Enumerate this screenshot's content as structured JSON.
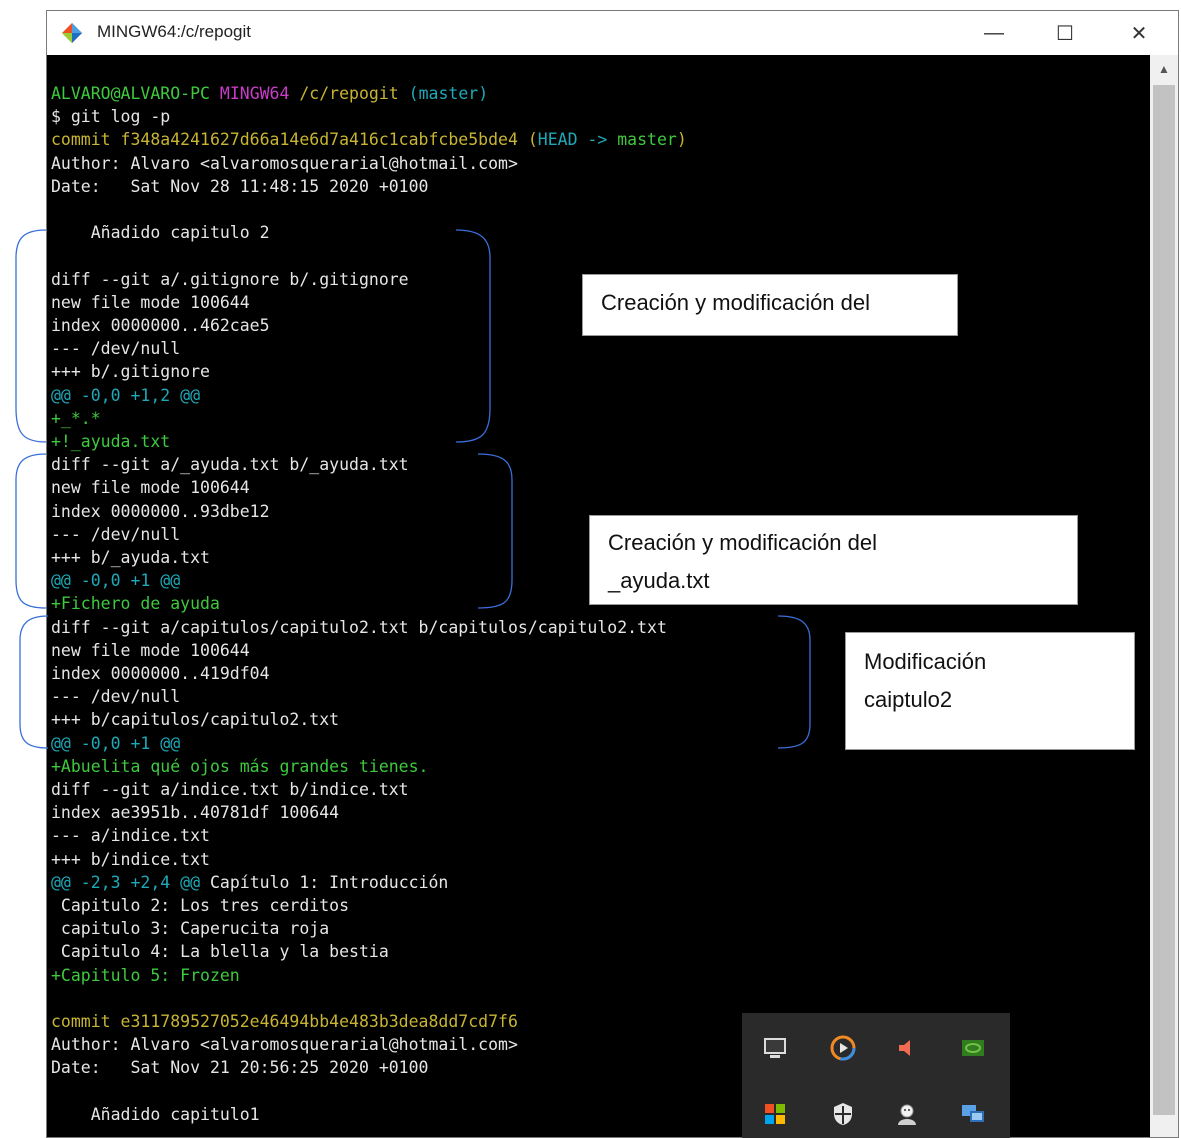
{
  "window": {
    "title": "MINGW64:/c/repogit",
    "controls": {
      "minimize": "—",
      "maximize": "☐",
      "close": "✕"
    }
  },
  "terminal": {
    "lines": [
      {
        "segments": [
          {
            "text": "ALVARO@ALVARO-PC ",
            "color": "green"
          },
          {
            "text": "MINGW64 ",
            "color": "magenta"
          },
          {
            "text": "/c/repogit ",
            "color": "yellow"
          },
          {
            "text": "(master)",
            "color": "cyan"
          }
        ]
      },
      {
        "segments": [
          {
            "text": "$ git log -p",
            "color": "white"
          }
        ]
      },
      {
        "segments": [
          {
            "text": "commit f348a4241627d66a14e6d7a416c1cabfcbe5bde4 ",
            "color": "yellow"
          },
          {
            "text": "(",
            "color": "yellow"
          },
          {
            "text": "HEAD -> ",
            "color": "cyan"
          },
          {
            "text": "master",
            "color": "green"
          },
          {
            "text": ")",
            "color": "yellow"
          }
        ]
      },
      {
        "segments": [
          {
            "text": "Author: Alvaro <alvaromosquerarial@hotmail.com>",
            "color": "white"
          }
        ]
      },
      {
        "segments": [
          {
            "text": "Date:   Sat Nov 28 11:48:15 2020 +0100",
            "color": "white"
          }
        ]
      },
      {
        "segments": [
          {
            "text": "",
            "color": "white"
          }
        ]
      },
      {
        "segments": [
          {
            "text": "    Añadido capitulo 2",
            "color": "white"
          }
        ]
      },
      {
        "segments": [
          {
            "text": "",
            "color": "white"
          }
        ]
      },
      {
        "segments": [
          {
            "text": "diff --git a/.gitignore b/.gitignore",
            "color": "white"
          }
        ]
      },
      {
        "segments": [
          {
            "text": "new file mode 100644",
            "color": "white"
          }
        ]
      },
      {
        "segments": [
          {
            "text": "index 0000000..462cae5",
            "color": "white"
          }
        ]
      },
      {
        "segments": [
          {
            "text": "--- /dev/null",
            "color": "white"
          }
        ]
      },
      {
        "segments": [
          {
            "text": "+++ b/.gitignore",
            "color": "white"
          }
        ]
      },
      {
        "segments": [
          {
            "text": "@@ -0,0 +1,2 @@",
            "color": "cyan"
          }
        ]
      },
      {
        "segments": [
          {
            "text": "+_*.*",
            "color": "green"
          }
        ]
      },
      {
        "segments": [
          {
            "text": "+!_ayuda.txt",
            "color": "green"
          }
        ]
      },
      {
        "segments": [
          {
            "text": "diff --git a/_ayuda.txt b/_ayuda.txt",
            "color": "white"
          }
        ]
      },
      {
        "segments": [
          {
            "text": "new file mode 100644",
            "color": "white"
          }
        ]
      },
      {
        "segments": [
          {
            "text": "index 0000000..93dbe12",
            "color": "white"
          }
        ]
      },
      {
        "segments": [
          {
            "text": "--- /dev/null",
            "color": "white"
          }
        ]
      },
      {
        "segments": [
          {
            "text": "+++ b/_ayuda.txt",
            "color": "white"
          }
        ]
      },
      {
        "segments": [
          {
            "text": "@@ -0,0 +1 @@",
            "color": "cyan"
          }
        ]
      },
      {
        "segments": [
          {
            "text": "+Fichero de ayuda",
            "color": "green"
          }
        ]
      },
      {
        "segments": [
          {
            "text": "diff --git a/capitulos/capitulo2.txt b/capitulos/capitulo2.txt",
            "color": "white"
          }
        ]
      },
      {
        "segments": [
          {
            "text": "new file mode 100644",
            "color": "white"
          }
        ]
      },
      {
        "segments": [
          {
            "text": "index 0000000..419df04",
            "color": "white"
          }
        ]
      },
      {
        "segments": [
          {
            "text": "--- /dev/null",
            "color": "white"
          }
        ]
      },
      {
        "segments": [
          {
            "text": "+++ b/capitulos/capitulo2.txt",
            "color": "white"
          }
        ]
      },
      {
        "segments": [
          {
            "text": "@@ -0,0 +1 @@",
            "color": "cyan"
          }
        ]
      },
      {
        "segments": [
          {
            "text": "+Abuelita qué ojos más grandes tienes.",
            "color": "green"
          }
        ]
      },
      {
        "segments": [
          {
            "text": "diff --git a/indice.txt b/indice.txt",
            "color": "white"
          }
        ]
      },
      {
        "segments": [
          {
            "text": "index ae3951b..40781df 100644",
            "color": "white"
          }
        ]
      },
      {
        "segments": [
          {
            "text": "--- a/indice.txt",
            "color": "white"
          }
        ]
      },
      {
        "segments": [
          {
            "text": "+++ b/indice.txt",
            "color": "white"
          }
        ]
      },
      {
        "segments": [
          {
            "text": "@@ -2,3 +2,4 @@ ",
            "color": "cyan"
          },
          {
            "text": "Capítulo 1: Introducción",
            "color": "white"
          }
        ]
      },
      {
        "segments": [
          {
            "text": " Capitulo 2: Los tres cerditos",
            "color": "white"
          }
        ]
      },
      {
        "segments": [
          {
            "text": " capitulo 3: Caperucita roja",
            "color": "white"
          }
        ]
      },
      {
        "segments": [
          {
            "text": " Capitulo 4: La blella y la bestia",
            "color": "white"
          }
        ]
      },
      {
        "segments": [
          {
            "text": "+Capitulo 5: Frozen",
            "color": "green"
          }
        ]
      },
      {
        "segments": [
          {
            "text": "",
            "color": "white"
          }
        ]
      },
      {
        "segments": [
          {
            "text": "commit e311789527052e46494bb4e483b3dea8dd7cd7f6",
            "color": "yellow"
          }
        ]
      },
      {
        "segments": [
          {
            "text": "Author: Alvaro <alvaromosquerarial@hotmail.com>",
            "color": "white"
          }
        ]
      },
      {
        "segments": [
          {
            "text": "Date:   Sat Nov 21 20:56:25 2020 +0100",
            "color": "white"
          }
        ]
      },
      {
        "segments": [
          {
            "text": "",
            "color": "white"
          }
        ]
      },
      {
        "segments": [
          {
            "text": "    Añadido capitulo1",
            "color": "white"
          }
        ]
      }
    ]
  },
  "annotations": [
    {
      "lines": [
        "Creación y modificación del"
      ]
    },
    {
      "lines": [
        "Creación y modificación del",
        "_ayuda.txt"
      ]
    },
    {
      "lines": [
        "Modificación",
        "caiptulo2"
      ]
    }
  ],
  "tray": {
    "icons": [
      "monitor-icon",
      "media-player-icon",
      "speaker-muted-icon",
      "nvidia-icon",
      "windows-update-icon",
      "security-shield-icon",
      "app-avatar-icon",
      "network-icon"
    ]
  },
  "colors": {
    "green": "#3ec93e",
    "magenta": "#c83cc8",
    "yellow": "#c8b432",
    "cyan": "#1ea9b8",
    "white": "#e6e6e6",
    "brace": "#3a6fd8"
  }
}
